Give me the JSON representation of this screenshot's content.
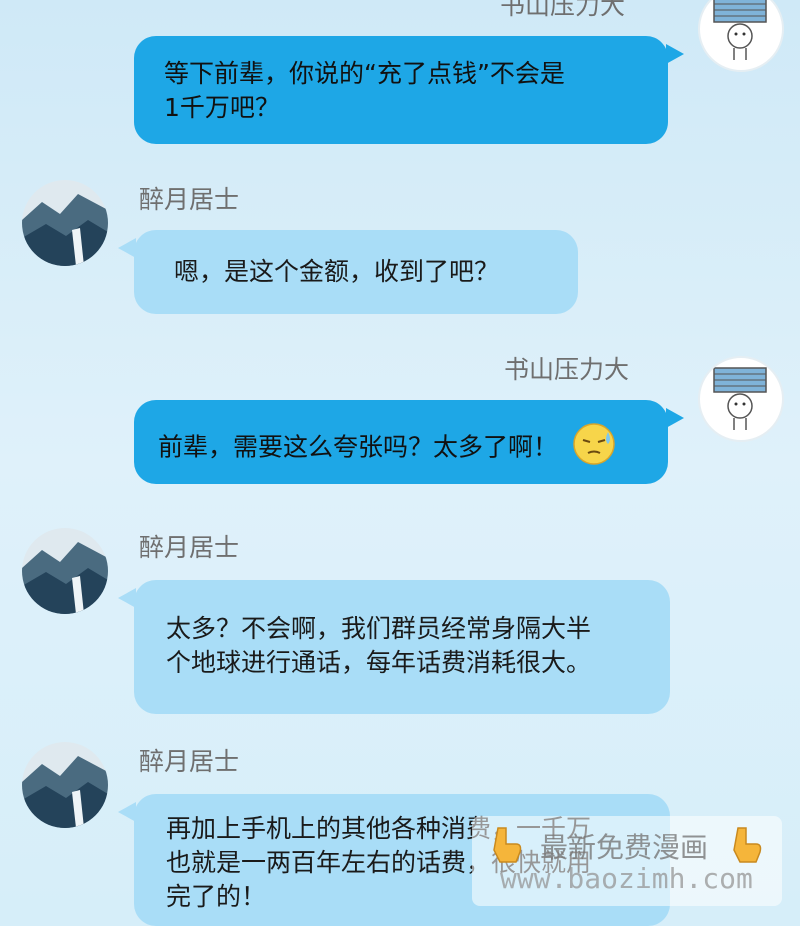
{
  "messages": [
    {
      "sender": "书山压力大",
      "side": "right",
      "lines": [
        "等下前辈，你说的“充了点钱”不会是",
        "1千万吧？"
      ]
    },
    {
      "sender": "醉月居士",
      "side": "left",
      "lines": [
        "嗯，是这个金额，收到了吧？"
      ]
    },
    {
      "sender": "书山压力大",
      "side": "right",
      "lines": [
        "前辈，需要这么夸张吗？太多了啊！"
      ],
      "emoji": "sweat-face-emoji"
    },
    {
      "sender": "醉月居士",
      "side": "left",
      "lines": [
        "太多？不会啊，我们群员经常身隔大半",
        "个地球进行通话，每年话费消耗很大。"
      ]
    },
    {
      "sender": "醉月居士",
      "side": "left",
      "lines": [
        "再加上手机上的其他各种消费，一千万",
        "也就是一两百年左右的话费，很快就用",
        "完了的！"
      ]
    }
  ],
  "watermark": {
    "title": "最新免费漫画",
    "url": "www.baozimh.com"
  },
  "colors": {
    "right_bubble": "#1ea7e6",
    "left_bubble": "#a9ddf7",
    "background": "#d6eef9"
  }
}
